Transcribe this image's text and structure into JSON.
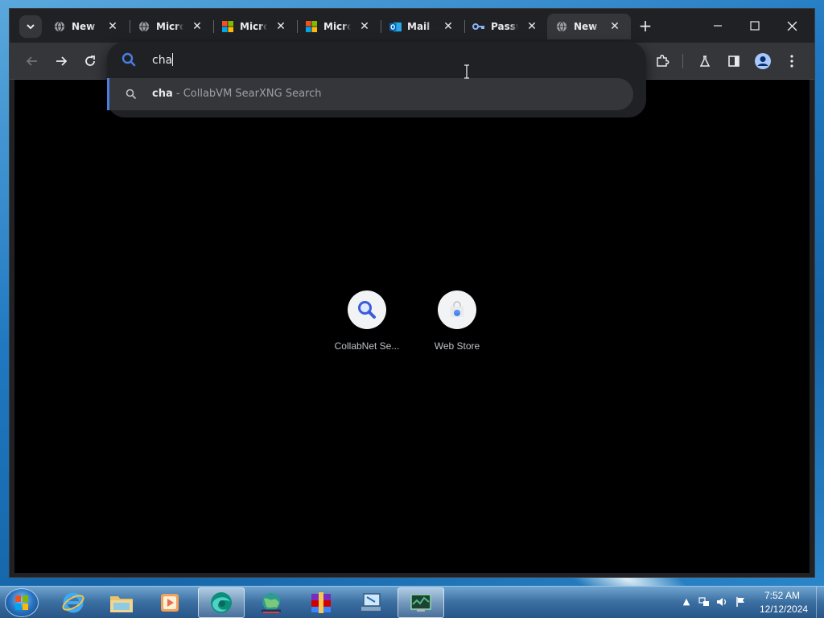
{
  "tabs": [
    {
      "title": "New Tab",
      "icon": "globe-icon",
      "active": false
    },
    {
      "title": "Microsoft",
      "icon": "globe-icon",
      "active": false
    },
    {
      "title": "Microsoft",
      "icon": "microsoft-logo-icon",
      "active": false
    },
    {
      "title": "Microsoft",
      "icon": "microsoft-logo-icon",
      "active": false
    },
    {
      "title": "Mail -",
      "icon": "outlook-icon",
      "active": false
    },
    {
      "title": "Passwords",
      "icon": "key-icon",
      "active": false
    },
    {
      "title": "New Tab",
      "icon": "globe-icon",
      "active": true
    }
  ],
  "omnibox": {
    "query": "cha",
    "suggestion": {
      "query": "cha",
      "separator": " - ",
      "description": "CollabVM SearXNG Search"
    }
  },
  "shortcuts": [
    {
      "label": "CollabNet Se...",
      "icon": "magnifier-icon"
    },
    {
      "label": "Web Store",
      "icon": "web-store-icon"
    }
  ],
  "taskbar": {
    "apps": [
      "internet-explorer-icon",
      "file-explorer-icon",
      "media-player-icon",
      "edge-icon",
      "network-globe-icon",
      "winrar-icon",
      "remote-desktop-icon",
      "task-manager-icon"
    ]
  },
  "clock": {
    "time": "7:52 AM",
    "date": "12/12/2024"
  },
  "colors": {
    "accent": "#4a7de0",
    "window_bg": "#202124",
    "toolbar_bg": "#35363a",
    "content_bg": "#000000"
  }
}
